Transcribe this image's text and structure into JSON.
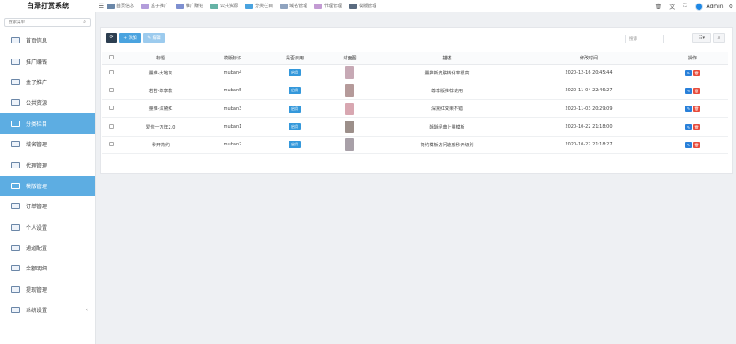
{
  "app": {
    "title": "白泽打赏系统",
    "admin": "Admin"
  },
  "topnav": [
    {
      "label": "首页信息",
      "color": "#6b87a8"
    },
    {
      "label": "盒子推广",
      "color": "#b39ddb"
    },
    {
      "label": "推广赚钱",
      "color": "#7e8fd0"
    },
    {
      "label": "公共资源",
      "color": "#66b3a6"
    },
    {
      "label": "分类栏目",
      "color": "#4aa3df"
    },
    {
      "label": "域名管理",
      "color": "#8fa3bf"
    },
    {
      "label": "代理管理",
      "color": "#c39bd3"
    },
    {
      "label": "模版管理",
      "color": "#5a6b80"
    }
  ],
  "search": {
    "placeholder": "搜索菜单"
  },
  "sidebar": [
    {
      "label": "首页信息",
      "active": false
    },
    {
      "label": "推广赚钱",
      "active": false
    },
    {
      "label": "盒子推广",
      "active": false
    },
    {
      "label": "公共资源",
      "active": false
    },
    {
      "label": "分类栏目",
      "active": true
    },
    {
      "label": "域名管理",
      "active": false
    },
    {
      "label": "代理管理",
      "active": false
    },
    {
      "label": "模版管理",
      "active": true
    },
    {
      "label": "订单管理",
      "active": false
    },
    {
      "label": "个人设置",
      "active": false
    },
    {
      "label": "通道配置",
      "active": false
    },
    {
      "label": "余额明细",
      "active": false
    },
    {
      "label": "提现管理",
      "active": false
    },
    {
      "label": "系统设置",
      "active": false
    }
  ],
  "toolbar": {
    "add": "+ 添加",
    "edit": "✎ 编辑",
    "search_placeholder": "搜索"
  },
  "table": {
    "headers": [
      "标题",
      "模版标识",
      "是否启用",
      "封面图",
      "描述",
      "修改时间",
      "操作"
    ],
    "rows": [
      {
        "title": "量推-大地灰",
        "id": "muban4",
        "status": "启用",
        "desc": "量推新皮肤转化率很高",
        "time": "2020-12-16 20:45:44",
        "thumb": "#c7a9b5"
      },
      {
        "title": "若若-尊享款",
        "id": "muban5",
        "status": "启用",
        "desc": "尊享版推荐使用",
        "time": "2020-11-04 22:46:27",
        "thumb": "#b59a9a"
      },
      {
        "title": "量推-深黛红",
        "id": "muban3",
        "status": "启用",
        "desc": "深黛红效果不错",
        "time": "2020-11-03 20:29:09",
        "thumb": "#d8a7b1"
      },
      {
        "title": "爱你一万年2.0",
        "id": "muban1",
        "status": "启用",
        "desc": "酥酥经典上量模板",
        "time": "2020-10-22 21:18:00",
        "thumb": "#9c8f8a"
      },
      {
        "title": "秒开简约",
        "id": "muban2",
        "status": "启用",
        "desc": "简约模板访问速度秒开级别",
        "time": "2020-10-22 21:18:27",
        "thumb": "#a8a0a8"
      }
    ]
  }
}
